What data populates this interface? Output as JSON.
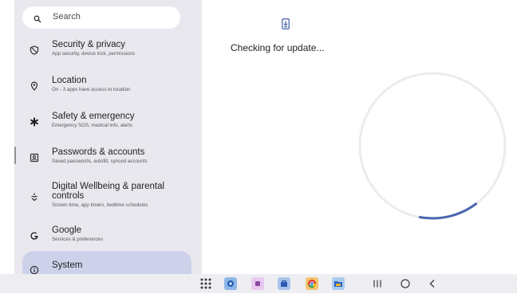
{
  "search": {
    "placeholder": "Search"
  },
  "settings_items": [
    {
      "title": "Security & privacy",
      "subtitle": "App security, device lock, permissions",
      "icon": "shield-icon"
    },
    {
      "title": "Location",
      "subtitle": "On - 3 apps have access to location",
      "icon": "location-pin-icon"
    },
    {
      "title": "Safety & emergency",
      "subtitle": "Emergency SOS, medical info, alerts",
      "icon": "asterisk-icon"
    },
    {
      "title": "Passwords & accounts",
      "subtitle": "Saved passwords, autofill, synced accounts",
      "icon": "account-box-icon"
    },
    {
      "title_line1": "Digital Wellbeing & parental",
      "title_line2": "controls",
      "subtitle": "Screen time, app timers, bedtime schedules",
      "icon": "wellbeing-icon"
    },
    {
      "title": "Google",
      "subtitle": "Services & preferences",
      "icon": "google-g-icon"
    },
    {
      "title": "System",
      "icon": "info-icon",
      "selected": true
    }
  ],
  "update": {
    "status_text": "Checking for update...",
    "icon": "system-update-icon"
  },
  "progress": {
    "fraction": 0.13
  },
  "colors": {
    "accent": "#4a67b0",
    "selected_bg": "#cdd2ea",
    "pane_bg": "#e9e8ee"
  },
  "taskbar": {
    "apps": [
      "app-drawer-icon",
      "camera-app-icon",
      "notes-app-icon",
      "store-app-icon",
      "chrome-app-icon",
      "files-app-icon"
    ],
    "nav": [
      "recents-icon",
      "home-icon",
      "back-icon"
    ]
  }
}
